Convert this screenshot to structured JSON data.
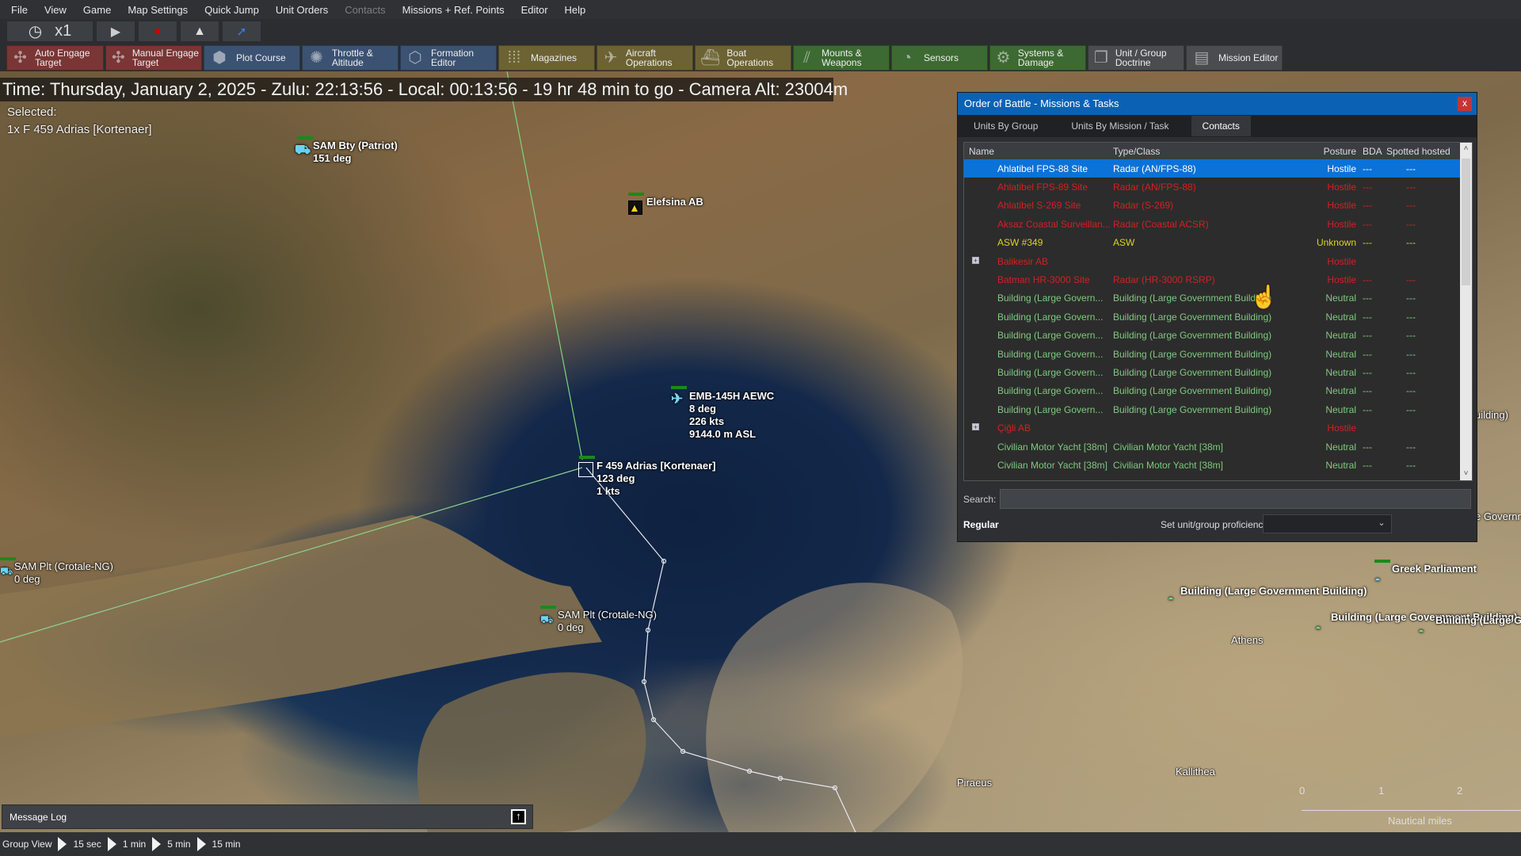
{
  "menu": [
    "File",
    "View",
    "Game",
    "Map Settings",
    "Quick Jump",
    "Unit Orders",
    "Contacts",
    "Missions + Ref. Points",
    "Editor",
    "Help"
  ],
  "menu_disabled": [
    "Contacts"
  ],
  "toolbar1": {
    "speed_label": "x1",
    "icons": [
      "clock-icon",
      "play-icon",
      "record-icon",
      "layers-icon",
      "jump-arrow-icon"
    ]
  },
  "toolbar2": [
    {
      "label": "Auto Engage Target",
      "color": "red",
      "icon": "auto-engage-icon"
    },
    {
      "label": "Manual Engage Target",
      "color": "red",
      "icon": "manual-engage-icon"
    },
    {
      "label": "Plot Course",
      "color": "blue",
      "icon": "plot-course-icon"
    },
    {
      "label": "Throttle & Altitude",
      "color": "blue",
      "icon": "throttle-icon"
    },
    {
      "label": "Formation Editor",
      "color": "blue",
      "icon": "formation-icon"
    },
    {
      "label": "Magazines",
      "color": "olive",
      "icon": "magazines-icon"
    },
    {
      "label": "Aircraft Operations",
      "color": "olive",
      "icon": "aircraft-icon"
    },
    {
      "label": "Boat Operations",
      "color": "olive",
      "icon": "boat-icon"
    },
    {
      "label": "Mounts & Weapons",
      "color": "green",
      "icon": "mounts-icon"
    },
    {
      "label": "Sensors",
      "color": "green",
      "icon": "sensors-icon"
    },
    {
      "label": "Systems & Damage",
      "color": "green",
      "icon": "systems-icon"
    },
    {
      "label": "Unit / Group Doctrine",
      "color": "grey",
      "icon": "doctrine-icon"
    },
    {
      "label": "Mission Editor",
      "color": "grey",
      "icon": "mission-editor-icon"
    }
  ],
  "time_banner": "Time: Thursday, January 2, 2025 - Zulu: 22:13:56 - Local: 00:13:56 - 19 hr 48 min to go -  Camera Alt: 23004m",
  "selected": {
    "label": "Selected:",
    "value": "1x F 459 Adrias [Kortenaer]"
  },
  "map_units": [
    {
      "name": "SAM Bty (Patriot)",
      "lines": [
        "151 deg"
      ]
    },
    {
      "name": "Elefsina AB",
      "lines": []
    },
    {
      "name": "EMB-145H AEWC",
      "lines": [
        "8 deg",
        "226 kts",
        "9144.0 m ASL"
      ]
    },
    {
      "name": "F 459 Adrias [Kortenaer]",
      "lines": [
        "123 deg",
        "1 kts"
      ]
    },
    {
      "name": "SAM Plt (Crotale-NG)",
      "lines": [
        "0 deg"
      ]
    },
    {
      "name": "SAM Plt (Crotale-NG)",
      "lines": [
        "0 deg"
      ]
    },
    {
      "name": "Greek Parliament",
      "lines": []
    },
    {
      "name": "Building (Large Government Building)",
      "lines": []
    },
    {
      "name": "Building (Large Government Building)",
      "lines": []
    },
    {
      "name": "Building (Large Go",
      "lines": []
    }
  ],
  "places": [
    "Athens",
    "Piraeus",
    "Kallithea"
  ],
  "partial_labels": [
    "uilding)",
    "e Governr"
  ],
  "scale_bar": {
    "ticks": [
      "0",
      "1",
      "2"
    ],
    "unit": "Nautical miles"
  },
  "dialog": {
    "title": "Order of Battle - Missions & Tasks",
    "close": "x",
    "tabs": [
      "Units By Group",
      "Units By Mission / Task",
      "Contacts"
    ],
    "active_tab": "Contacts",
    "columns": [
      "Name",
      "Type/Class",
      "Posture",
      "BDA",
      "Spotted hosted"
    ],
    "rows": [
      {
        "name": "Ahlatibel FPS-88 Site",
        "type": "Radar (AN/FPS-88)",
        "posture": "Hostile",
        "bda": "---",
        "spotted": "---",
        "selected": true
      },
      {
        "name": "Ahlatibel FPS-89 Site",
        "type": "Radar (AN/FPS-88)",
        "posture": "Hostile",
        "bda": "---",
        "spotted": "---"
      },
      {
        "name": "Ahlatibel S-269 Site",
        "type": "Radar (S-269)",
        "posture": "Hostile",
        "bda": "---",
        "spotted": "---"
      },
      {
        "name": "Aksaz Coastal Surveillan...",
        "type": "Radar (Coastal ACSR)",
        "posture": "Hostile",
        "bda": "---",
        "spotted": "---"
      },
      {
        "name": "ASW #349",
        "type": "ASW",
        "posture": "Unknown",
        "bda": "---",
        "spotted": "---"
      },
      {
        "name": "Balikesir AB",
        "type": "",
        "posture": "Hostile",
        "bda": "",
        "spotted": "",
        "expandable": true
      },
      {
        "name": "Batman HR-3000 Site",
        "type": "Radar (HR-3000 RSRP)",
        "posture": "Hostile",
        "bda": "---",
        "spotted": "---"
      },
      {
        "name": "Building (Large Govern...",
        "type": "Building (Large Government Building)",
        "posture": "Neutral",
        "bda": "---",
        "spotted": "---"
      },
      {
        "name": "Building (Large Govern...",
        "type": "Building (Large Government Building)",
        "posture": "Neutral",
        "bda": "---",
        "spotted": "---"
      },
      {
        "name": "Building (Large Govern...",
        "type": "Building (Large Government Building)",
        "posture": "Neutral",
        "bda": "---",
        "spotted": "---"
      },
      {
        "name": "Building (Large Govern...",
        "type": "Building (Large Government Building)",
        "posture": "Neutral",
        "bda": "---",
        "spotted": "---"
      },
      {
        "name": "Building (Large Govern...",
        "type": "Building (Large Government Building)",
        "posture": "Neutral",
        "bda": "---",
        "spotted": "---"
      },
      {
        "name": "Building (Large Govern...",
        "type": "Building (Large Government Building)",
        "posture": "Neutral",
        "bda": "---",
        "spotted": "---"
      },
      {
        "name": "Building (Large Govern...",
        "type": "Building (Large Government Building)",
        "posture": "Neutral",
        "bda": "---",
        "spotted": "---"
      },
      {
        "name": "Çiğli AB",
        "type": "",
        "posture": "Hostile",
        "bda": "",
        "spotted": "",
        "expandable": true
      },
      {
        "name": "Civilian Motor Yacht [38m]",
        "type": "Civilian Motor Yacht [38m]",
        "posture": "Neutral",
        "bda": "---",
        "spotted": "---"
      },
      {
        "name": "Civilian Motor Yacht [38m]",
        "type": "Civilian Motor Yacht [38m]",
        "posture": "Neutral",
        "bda": "---",
        "spotted": "---"
      }
    ],
    "search": {
      "label": "Search:",
      "value": ""
    },
    "proficiency": {
      "current": "Regular",
      "label": "Set unit/group proficiency:",
      "selected": ""
    }
  },
  "message_log": {
    "label": "Message Log"
  },
  "group_view": {
    "label": "Group View",
    "steps": [
      "15 sec",
      "1 min",
      "5 min",
      "15 min"
    ]
  },
  "colors": {
    "hostile": "#d42020",
    "unknown": "#d9d424",
    "neutral": "#7fc97f",
    "selection": "#0b72d8",
    "title_bar": "#0b62b5"
  }
}
